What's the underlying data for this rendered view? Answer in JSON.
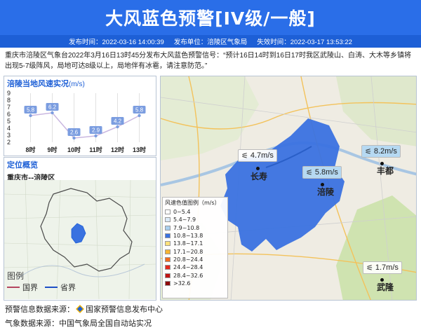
{
  "header": {
    "title": "大风蓝色预警[IV级/一般]"
  },
  "meta": {
    "publish_time": "发布时间：2022-03-16 14:00:39",
    "publisher": "发布单位：涪陵区气象局",
    "expire_time": "失效时间：2022-03-17 13:53:22"
  },
  "description": "重庆市涪陵区气象台2022年3月16日13时45分发布大风蓝色预警信号：“预计16日14时到16日17时我区武陵山、白涛、大木等乡镇将出现5-7级阵风，局地可达8级以上，局地伴有冰雹，请注意防范。”",
  "wind_panel": {
    "title": "涪陵当地风速实况",
    "unit": "(m/s)"
  },
  "chart_data": {
    "type": "line",
    "categories": [
      "8时",
      "9时",
      "10时",
      "11时",
      "12时",
      "13时"
    ],
    "values": [
      5.8,
      6.2,
      2.6,
      2.9,
      4.2,
      5.8
    ],
    "ylim": [
      2,
      9
    ],
    "yticks": [
      "9",
      "8",
      "7",
      "6",
      "5",
      "4",
      "3",
      "2"
    ],
    "grid": true,
    "colors": {
      "line": "#c9b6e0",
      "point": "#7b9de0"
    }
  },
  "location_panel": {
    "title": "定位概览",
    "subtitle": "重庆市--涪陵区"
  },
  "mini_legend": {
    "title": "图例",
    "items": [
      "国界",
      "省界"
    ]
  },
  "map_legend": {
    "title": "风速色值图例（m/s）",
    "items": [
      {
        "label": "0~5.4",
        "color": "#ffffff"
      },
      {
        "label": "5.4~7.9",
        "color": "#dbeaf7"
      },
      {
        "label": "7.9~10.8",
        "color": "#a9d0ef"
      },
      {
        "label": "10.8~13.8",
        "color": "#3a72e0"
      },
      {
        "label": "13.8~17.1",
        "color": "#ffe17a"
      },
      {
        "label": "17.1~20.8",
        "color": "#f7b531"
      },
      {
        "label": "20.8~24.4",
        "color": "#f26b1d"
      },
      {
        "label": "24.4~28.4",
        "color": "#e5281c"
      },
      {
        "label": "28.4~32.6",
        "color": "#c11412"
      },
      {
        "label": ">32.6",
        "color": "#8e0a0a"
      }
    ]
  },
  "stations": [
    {
      "name": "长寿",
      "speed": "4.7m/s"
    },
    {
      "name": "涪陵",
      "speed": "5.8m/s"
    },
    {
      "name": "丰都",
      "speed": "8.2m/s"
    },
    {
      "name": "武隆",
      "speed": "1.7m/s"
    }
  ],
  "footer": {
    "warning_source": "预警信息数据来源：",
    "warning_source_org": "国家预警信息发布中心",
    "weather_source": "气象数据来源：中国气象局全国自动站实况"
  }
}
